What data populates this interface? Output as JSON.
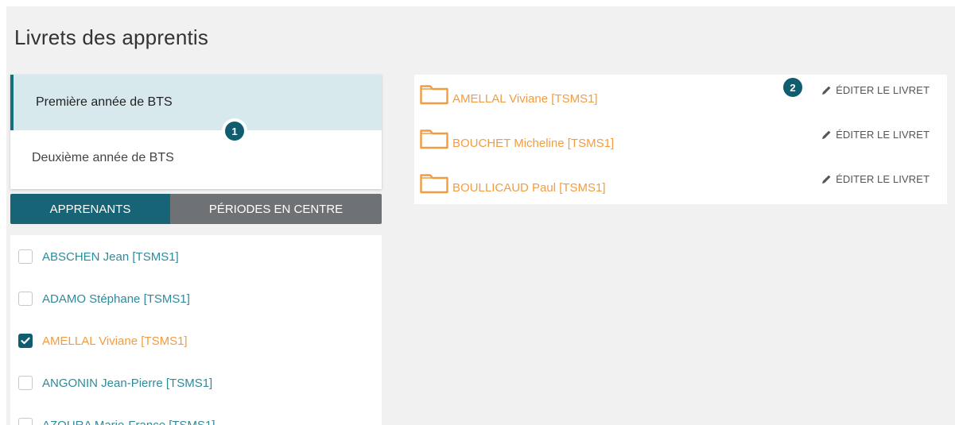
{
  "page": {
    "title": "Livrets des apprentis"
  },
  "years": [
    {
      "label": "Première année de BTS",
      "active": true
    },
    {
      "label": "Deuxième année de BTS",
      "active": false
    }
  ],
  "badges": {
    "one": "1",
    "two": "2"
  },
  "tabs": [
    {
      "label": "APPRENANTS",
      "active": true
    },
    {
      "label": "PÉRIODES EN CENTRE",
      "active": false
    }
  ],
  "learners": [
    {
      "name": "ABSCHEN Jean [TSMS1]",
      "checked": false
    },
    {
      "name": "ADAMO Stéphane [TSMS1]",
      "checked": false
    },
    {
      "name": "AMELLAL Viviane [TSMS1]",
      "checked": true
    },
    {
      "name": "ANGONIN Jean-Pierre [TSMS1]",
      "checked": false
    },
    {
      "name": "AZOURA Marie-France [TSMS1]",
      "checked": false
    }
  ],
  "booklets": [
    {
      "name": "AMELLAL Viviane [TSMS1]",
      "edit_label": "ÉDITER LE LIVRET"
    },
    {
      "name": "BOUCHET Micheline [TSMS1]",
      "edit_label": "ÉDITER LE LIVRET"
    },
    {
      "name": "BOULLICAUD Paul [TSMS1]",
      "edit_label": "ÉDITER LE LIVRET"
    }
  ],
  "colors": {
    "accent": "#166475",
    "highlight": "#f39c3f",
    "link": "#2e8b9b",
    "tab_inactive": "#6f7274",
    "selected_bg": "#d7e9ed"
  },
  "icons": {
    "folder": "folder-icon",
    "pencil": "pencil-icon",
    "check": "checkmark-icon"
  }
}
